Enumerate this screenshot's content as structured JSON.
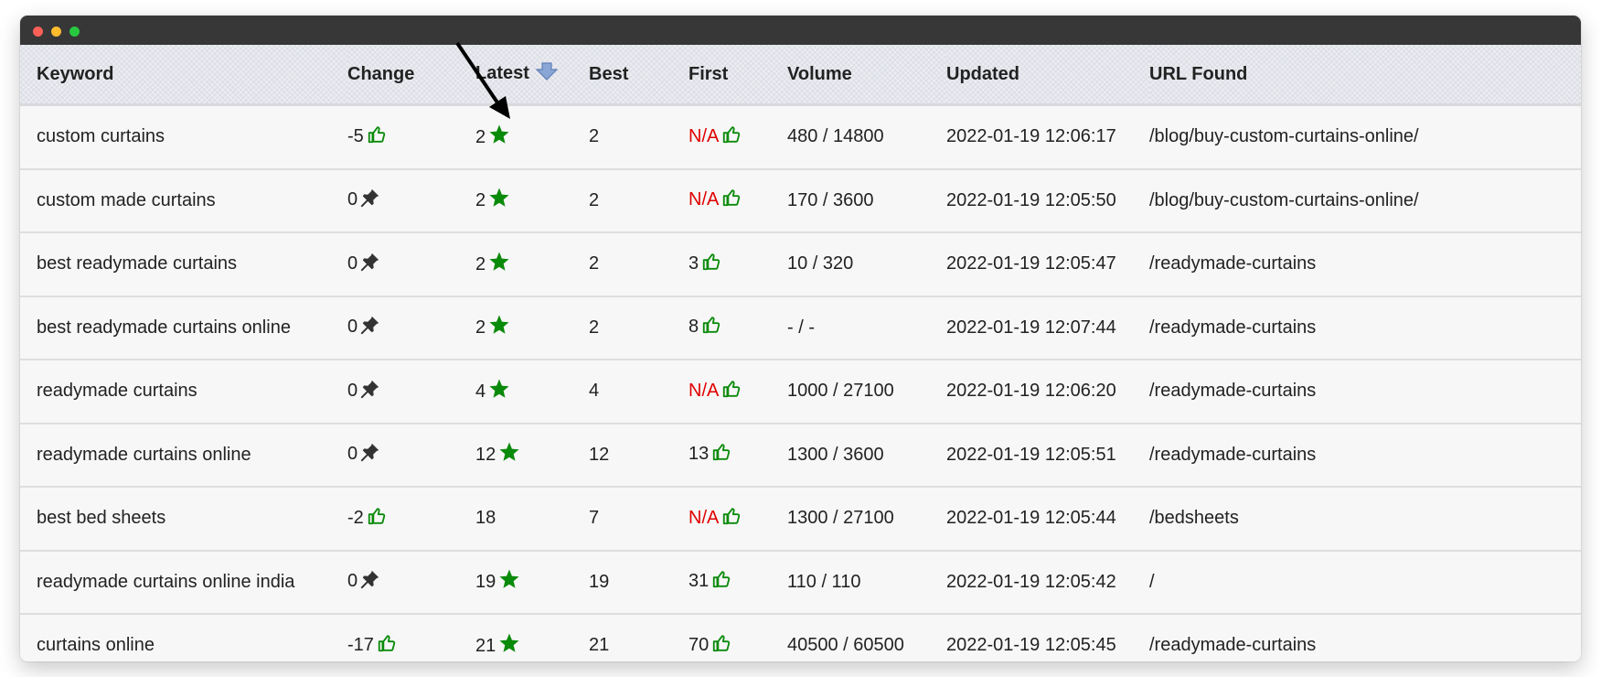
{
  "columns": {
    "keyword": "Keyword",
    "change": "Change",
    "latest": "Latest",
    "best": "Best",
    "first": "First",
    "volume": "Volume",
    "updated": "Updated",
    "url": "URL Found"
  },
  "icons": {
    "sort": "sort-down-icon",
    "improved": "thumbs-up-icon",
    "unchanged": "pin-icon",
    "top": "star-icon"
  },
  "colors": {
    "green": "#0a8a0a",
    "na_red": "#e00000"
  },
  "rows": [
    {
      "keyword": "custom curtains",
      "change": "-5",
      "change_icon": "thumb",
      "latest": "2",
      "latest_star": true,
      "best": "2",
      "first": "N/A",
      "volume": "480 / 14800",
      "updated": "2022-01-19 12:06:17",
      "url": "/blog/buy-custom-curtains-online/"
    },
    {
      "keyword": "custom made curtains",
      "change": "0",
      "change_icon": "pin",
      "latest": "2",
      "latest_star": true,
      "best": "2",
      "first": "N/A",
      "volume": "170 / 3600",
      "updated": "2022-01-19 12:05:50",
      "url": "/blog/buy-custom-curtains-online/"
    },
    {
      "keyword": "best readymade curtains",
      "change": "0",
      "change_icon": "pin",
      "latest": "2",
      "latest_star": true,
      "best": "2",
      "first": "3",
      "volume": "10 / 320",
      "updated": "2022-01-19 12:05:47",
      "url": "/readymade-curtains"
    },
    {
      "keyword": "best readymade curtains online",
      "change": "0",
      "change_icon": "pin",
      "latest": "2",
      "latest_star": true,
      "best": "2",
      "first": "8",
      "volume": "- / -",
      "updated": "2022-01-19 12:07:44",
      "url": "/readymade-curtains"
    },
    {
      "keyword": "readymade curtains",
      "change": "0",
      "change_icon": "pin",
      "latest": "4",
      "latest_star": true,
      "best": "4",
      "first": "N/A",
      "volume": "1000 / 27100",
      "updated": "2022-01-19 12:06:20",
      "url": "/readymade-curtains"
    },
    {
      "keyword": "readymade curtains online",
      "change": "0",
      "change_icon": "pin",
      "latest": "12",
      "latest_star": true,
      "best": "12",
      "first": "13",
      "volume": "1300 / 3600",
      "updated": "2022-01-19 12:05:51",
      "url": "/readymade-curtains"
    },
    {
      "keyword": "best bed sheets",
      "change": "-2",
      "change_icon": "thumb",
      "latest": "18",
      "latest_star": false,
      "best": "7",
      "first": "N/A",
      "volume": "1300 / 27100",
      "updated": "2022-01-19 12:05:44",
      "url": "/bedsheets"
    },
    {
      "keyword": "readymade curtains online india",
      "change": "0",
      "change_icon": "pin",
      "latest": "19",
      "latest_star": true,
      "best": "19",
      "first": "31",
      "volume": "110 / 110",
      "updated": "2022-01-19 12:05:42",
      "url": "/"
    },
    {
      "keyword": "curtains online",
      "change": "-17",
      "change_icon": "thumb",
      "latest": "21",
      "latest_star": true,
      "best": "21",
      "first": "70",
      "volume": "40500 / 60500",
      "updated": "2022-01-19 12:05:45",
      "url": "/readymade-curtains"
    }
  ]
}
